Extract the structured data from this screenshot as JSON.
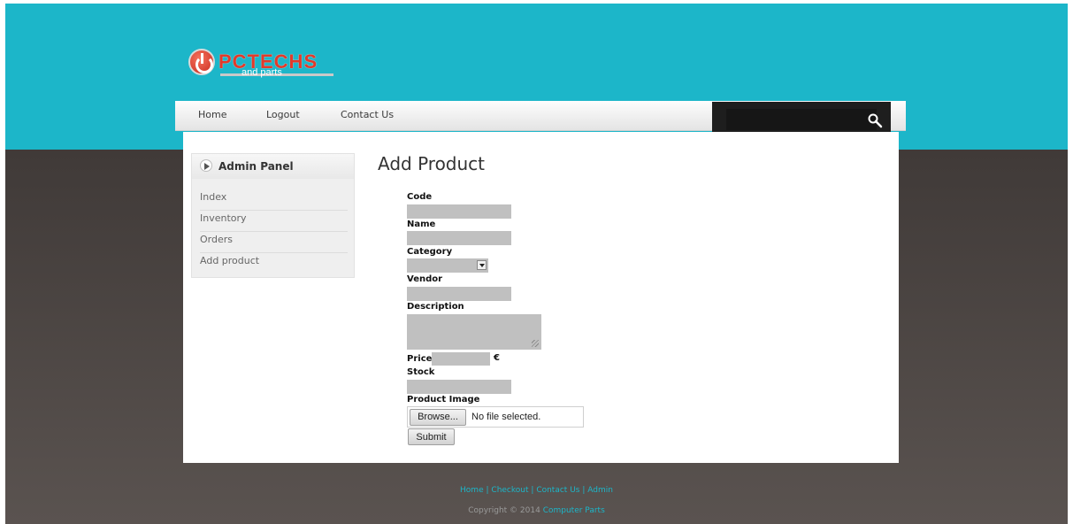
{
  "logo": {
    "name": "PCTECHS",
    "tagline": "and parts"
  },
  "nav": {
    "items": [
      {
        "label": "Home"
      },
      {
        "label": "Logout"
      },
      {
        "label": "Contact Us"
      }
    ],
    "search_value": ""
  },
  "sidebar": {
    "title": "Admin Panel",
    "items": [
      {
        "label": "Index"
      },
      {
        "label": "Inventory"
      },
      {
        "label": "Orders"
      },
      {
        "label": "Add product"
      }
    ]
  },
  "form": {
    "title": "Add Product",
    "code_label": "Code",
    "name_label": "Name",
    "category_label": "Category",
    "vendor_label": "Vendor",
    "description_label": "Description",
    "price_label": "Price",
    "currency": "€",
    "stock_label": "Stock",
    "image_label": "Product Image",
    "browse_label": "Browse...",
    "file_status": "No file selected.",
    "submit_label": "Submit"
  },
  "footer": {
    "links": [
      {
        "label": "Home"
      },
      {
        "label": "Checkout"
      },
      {
        "label": "Contact Us"
      },
      {
        "label": "Admin"
      }
    ],
    "separator": "|",
    "copyright_prefix": "Copyright © 2014",
    "copyright_link": "Computer Parts"
  },
  "colors": {
    "accent": "#1cb6c9",
    "logo_red": "#e23a2a",
    "background_dark": "#4a4442"
  }
}
